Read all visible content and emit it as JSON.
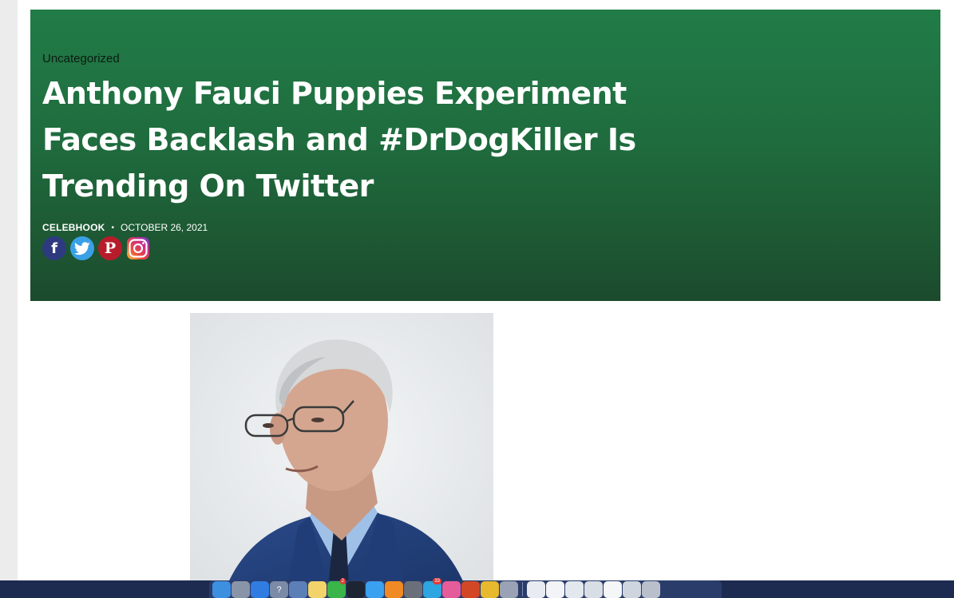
{
  "article": {
    "category": "Uncategorized",
    "title": "Anthony Fauci Puppies Experiment Faces Backlash and #DrDogKiller Is Trending On Twitter",
    "author": "CELEBHOOK",
    "separator": "•",
    "date": "OCTOBER 26, 2021"
  },
  "social": [
    {
      "name": "facebook",
      "glyph": "f",
      "color": "#2e3a80"
    },
    {
      "name": "twitter",
      "glyph": "",
      "color": "#3aa0e6"
    },
    {
      "name": "pinterest",
      "glyph": "P",
      "color": "#b71c2a"
    },
    {
      "name": "instagram",
      "glyph": "",
      "color": "#d62976"
    }
  ],
  "dock": {
    "apps": [
      {
        "name": "finder-icon",
        "color": "#3d8fe0"
      },
      {
        "name": "launchpad-icon",
        "color": "#8a94a8"
      },
      {
        "name": "safari-icon",
        "color": "#2f7de1"
      },
      {
        "name": "help-icon",
        "color": "#7b8aa6"
      },
      {
        "name": "preview-icon",
        "color": "#5c7fb8"
      },
      {
        "name": "notes-icon",
        "color": "#f2d46a"
      },
      {
        "name": "facetime-icon",
        "color": "#3ab54a",
        "badge": "2"
      },
      {
        "name": "quicktime-icon",
        "color": "#1d2533"
      },
      {
        "name": "messages-icon",
        "color": "#3aa0f0"
      },
      {
        "name": "pages-icon",
        "color": "#f08a24"
      },
      {
        "name": "system-preferences-icon",
        "color": "#6b6f7a"
      },
      {
        "name": "telegram-icon",
        "color": "#2ca5e0",
        "badge": "33"
      },
      {
        "name": "itunes-icon",
        "color": "#e55c9a"
      },
      {
        "name": "powerpoint-icon",
        "color": "#d24726"
      },
      {
        "name": "chrome-icon",
        "color": "#e8b82e"
      },
      {
        "name": "scanner-icon",
        "color": "#9aa3b5"
      }
    ],
    "docs": [
      {
        "name": "document-thumbnail-icon"
      },
      {
        "name": "document-thumbnail-icon"
      },
      {
        "name": "document-thumbnail-icon"
      },
      {
        "name": "document-thumbnail-icon"
      },
      {
        "name": "document-thumbnail-icon"
      },
      {
        "name": "document-thumbnail-icon"
      },
      {
        "name": "trash-icon"
      }
    ]
  }
}
